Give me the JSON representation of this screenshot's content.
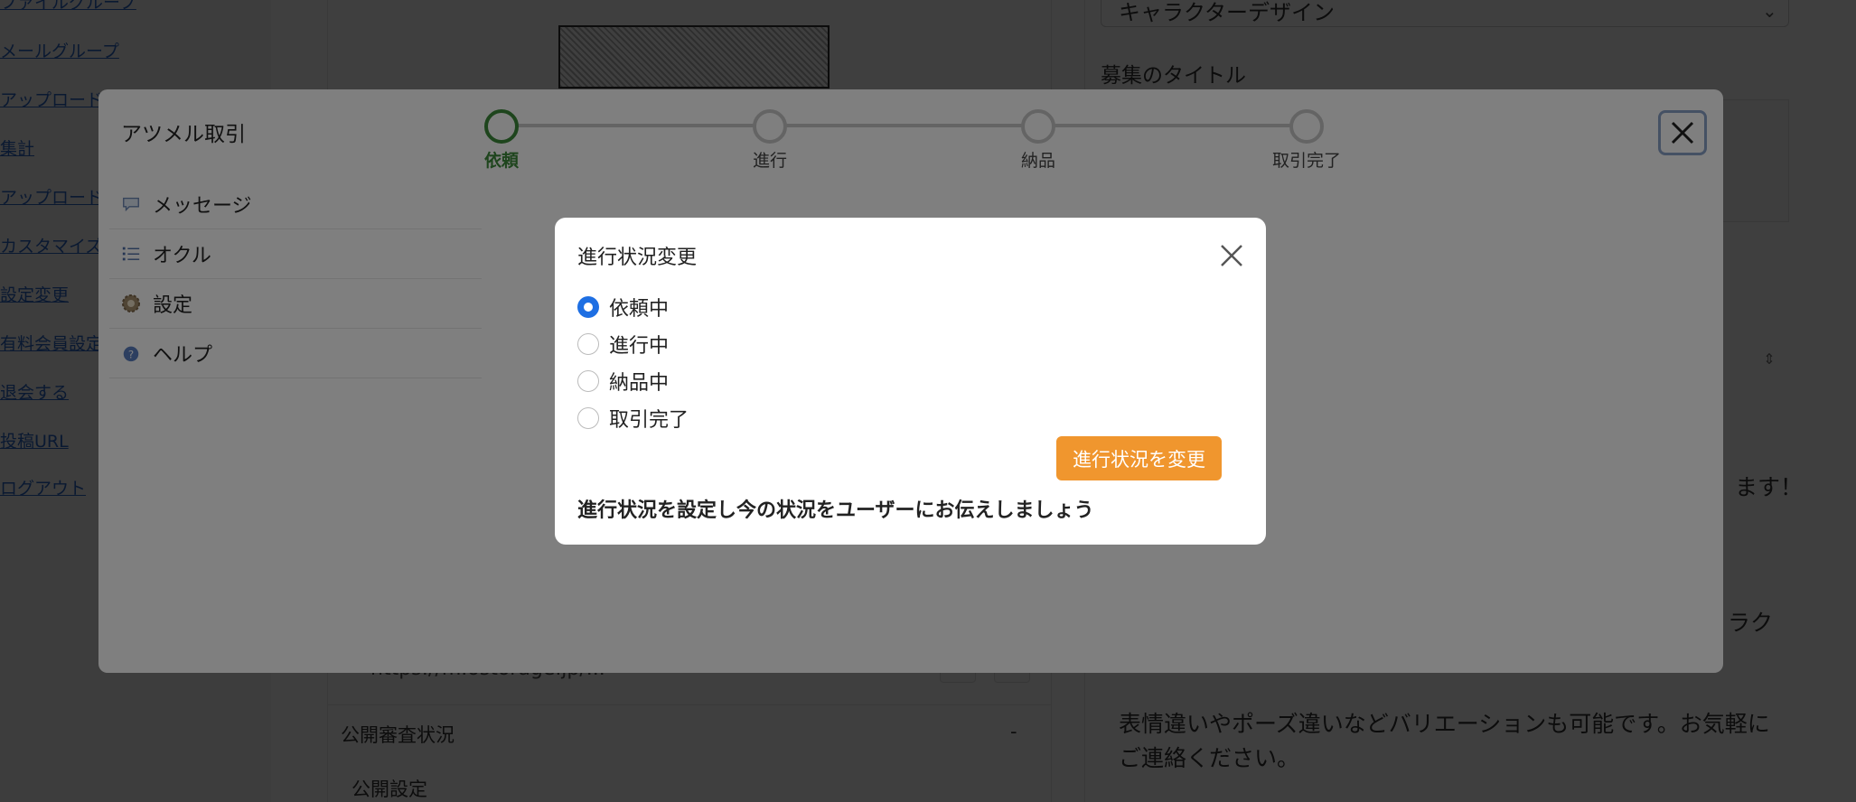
{
  "background": {
    "left_links": [
      "ファイルグループ",
      "メールグループ",
      "アップロード",
      "集計",
      "アップロード",
      "カスタマイズ",
      "設定変更",
      "有料会員設定",
      "退会する",
      "投稿URL",
      "ログアウト"
    ],
    "mid": {
      "url_text": "https://m.ostorage.jp/...",
      "rows": [
        "公開審査状況",
        "公開設定"
      ],
      "dash": "-"
    },
    "right": {
      "select_value": "キャラクターデザイン",
      "field_title": "募集のタイトル",
      "text_fragment_1": "ます！",
      "text_fragment_2": "ラク",
      "paragraph_line1": "表情違いやポーズ違いなどバリエーションも可能です。お気軽に",
      "paragraph_line2": "ご連絡ください。"
    }
  },
  "trade_modal": {
    "title": "アツメル取引",
    "steps": [
      {
        "label": "依頼",
        "active": true
      },
      {
        "label": "進行",
        "active": false
      },
      {
        "label": "納品",
        "active": false
      },
      {
        "label": "取引完了",
        "active": false
      }
    ],
    "menu": [
      {
        "label": "メッセージ",
        "icon": "speech-bubble-icon"
      },
      {
        "label": "オクル",
        "icon": "list-icon"
      },
      {
        "label": "設定",
        "icon": "gear-icon"
      },
      {
        "label": "ヘルプ",
        "icon": "help-icon"
      }
    ]
  },
  "status_dialog": {
    "title": "進行状況変更",
    "options": [
      {
        "label": "依頼中",
        "checked": true
      },
      {
        "label": "進行中",
        "checked": false
      },
      {
        "label": "納品中",
        "checked": false
      },
      {
        "label": "取引完了",
        "checked": false
      }
    ],
    "submit_label": "進行状況を変更",
    "hint": "進行状況を設定し今の状況をユーザーにお伝えしましょう"
  },
  "colors": {
    "step_active": "#3d8a3a",
    "radio_checked": "#1e6fe3",
    "submit_button": "#f0962e",
    "link": "#2a64c6"
  }
}
